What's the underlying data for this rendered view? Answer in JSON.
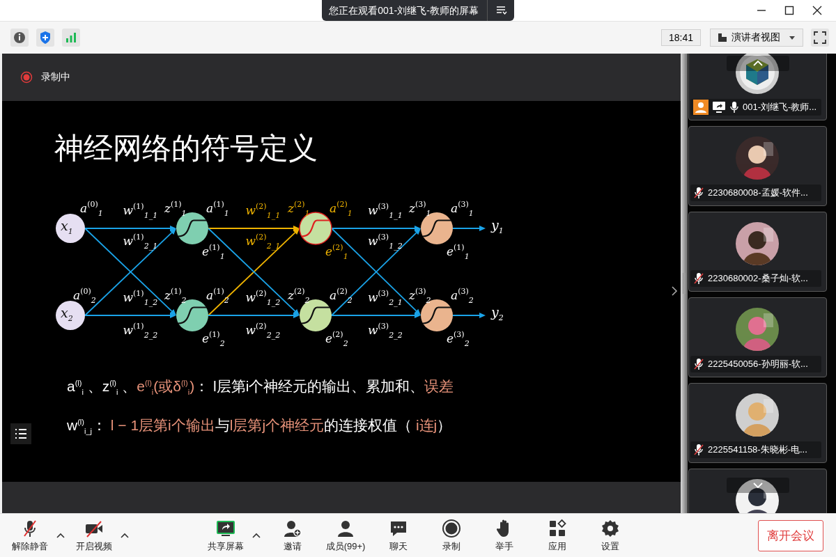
{
  "window": {
    "title": "您正在观看001-刘继飞-教师的屏幕",
    "time": "18:41",
    "view_mode": "演讲者视图"
  },
  "recording": {
    "label": "录制中"
  },
  "slide": {
    "title": "神经网络的符号定义",
    "layers": [
      {
        "kind": "input",
        "nodes": [
          {
            "label": "x$_{1}$",
            "a": "a$^{(0)}$$_{1}$",
            "highlighted": false
          },
          {
            "label": "x$_{2}$",
            "a": "a$^{(0)}$$_{2}$",
            "highlighted": false
          }
        ]
      },
      {
        "kind": "hidden",
        "nodes": [
          {
            "z": "z$^{(1)}$$_{1}$",
            "a": "a$^{(1)}$$_{1}$",
            "e": "e$^{(1)}$$_{1}$",
            "highlighted": false
          },
          {
            "z": "z$^{(1)}$$_{2}$",
            "a": "a$^{(1)}$$_{2}$",
            "e": "e$^{(1)}$$_{2}$",
            "highlighted": false
          }
        ]
      },
      {
        "kind": "hidden2",
        "nodes": [
          {
            "z": "z$^{(2)}$$_{1}$",
            "a": "a$^{(2)}$$_{1}$",
            "e": "e$^{(2)}$$_{1}$",
            "highlighted": true
          },
          {
            "z": "z$^{(2)}$$_{2}$",
            "a": "a$^{(2)}$$_{2}$",
            "e": "e$^{(2)}$$_{2}$",
            "highlighted": false
          }
        ]
      },
      {
        "kind": "output",
        "nodes": [
          {
            "z": "z$^{(3)}$$_{1}$",
            "a": "a$^{(3)}$$_{1}$",
            "e": "e$^{(1)}$$_{1}$",
            "y": "y$_{1}$",
            "highlighted": false
          },
          {
            "z": "z$^{(3)}$$_{2}$",
            "a": "a$^{(3)}$$_{2}$",
            "e": "e$^{(3)}$$_{2}$",
            "y": "y$_{2}$",
            "highlighted": false
          }
        ]
      }
    ],
    "edges": [
      [
        {
          "label": "w$^{(1)}$$_{1_1}$",
          "highlighted": false
        },
        {
          "label": "w$^{(1)}$$_{2_1}$",
          "highlighted": false
        },
        {
          "label": "w$^{(1)}$$_{1_2}$",
          "highlighted": false
        },
        {
          "label": "w$^{(1)}$$_{2_2}$",
          "highlighted": false
        }
      ],
      [
        {
          "label": "w$^{(2)}$$_{1_1}$",
          "highlighted": true
        },
        {
          "label": "w$^{(2)}$$_{2_1}$",
          "highlighted": true
        },
        {
          "label": "w$^{(2)}$$_{1_2}$",
          "highlighted": false
        },
        {
          "label": "w$^{(2)}$$_{2_2}$",
          "highlighted": false
        }
      ],
      [
        {
          "label": "w$^{(3)}$$_{1_1}$",
          "highlighted": false
        },
        {
          "label": "w$^{(3)}$$_{1_2}$",
          "highlighted": false
        },
        {
          "label": "w$^{(3)}$$_{2_1}$",
          "highlighted": false
        },
        {
          "label": "w$^{(3)}$$_{2_2}$",
          "highlighted": false
        }
      ]
    ],
    "definitions": [
      [
        {
          "text": "a$^{(l)}$$_{i}$ 、z$^{(l)}$$_{i}$ 、",
          "accent": false
        },
        {
          "text": "e$^{(l)}$$_{i}$(或δ$^{(l)}$$_{i}$)",
          "accent": true
        },
        {
          "text": "： l层第i个神经元的输出、累加和、",
          "accent": false
        },
        {
          "text": "误差",
          "accent": true
        }
      ],
      [
        {
          "text": "w$^{(l)}$$_{i_j}$： ",
          "accent": false
        },
        {
          "text": "l − 1层第i个输出",
          "accent": true
        },
        {
          "text": "与",
          "accent": false
        },
        {
          "text": "l层第j个神经元",
          "accent": true
        },
        {
          "text": "的连接权值（ ",
          "accent": false
        },
        {
          "text": "i连j",
          "accent": true
        },
        {
          "text": "）",
          "accent": false
        }
      ]
    ]
  },
  "participants": [
    {
      "name": "001-刘继飞-教师...",
      "kind": "host"
    },
    {
      "name": "2230680008-孟媛-软件...",
      "kind": "muted"
    },
    {
      "name": "2230680002-桑子灿-软...",
      "kind": "muted"
    },
    {
      "name": "2225450056-孙明丽-软...",
      "kind": "muted"
    },
    {
      "name": "2225541158-朱晓彬-电...",
      "kind": "muted"
    },
    {
      "kind": "partial"
    }
  ],
  "toolbar": [
    {
      "label": "解除静音",
      "kind": "mic",
      "dropdown": true
    },
    {
      "label": "开启视频",
      "kind": "video",
      "dropdown": true
    },
    {
      "label": "共享屏幕",
      "kind": "share",
      "dropdown": true
    },
    {
      "label": "邀请",
      "kind": "invite",
      "dropdown": false
    },
    {
      "label": "成员(99+)",
      "kind": "members",
      "dropdown": false
    },
    {
      "label": "聊天",
      "kind": "chat",
      "dropdown": false
    },
    {
      "label": "录制",
      "kind": "record",
      "dropdown": false
    },
    {
      "label": "举手",
      "kind": "hand",
      "dropdown": false
    },
    {
      "label": "应用",
      "kind": "apps",
      "dropdown": false
    },
    {
      "label": "设置",
      "kind": "settings",
      "dropdown": false
    }
  ],
  "leave_button": "离开会议"
}
